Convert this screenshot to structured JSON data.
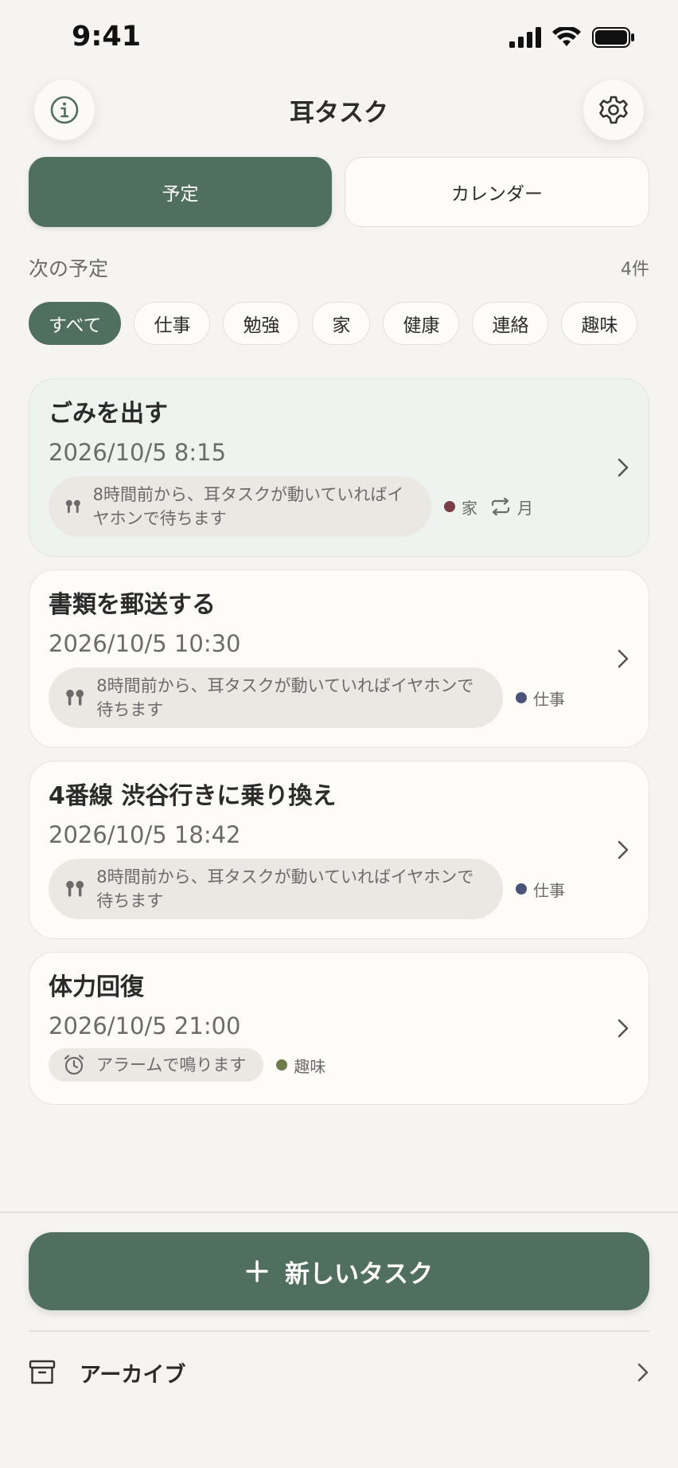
{
  "status": {
    "time": "9:41"
  },
  "header": {
    "title": "耳タスク"
  },
  "segments": [
    {
      "label": "予定",
      "active": true
    },
    {
      "label": "カレンダー",
      "active": false
    }
  ],
  "section": {
    "title": "次の予定",
    "count": "4件"
  },
  "filters": [
    "すべて",
    "仕事",
    "勉強",
    "家",
    "健康",
    "連絡",
    "趣味"
  ],
  "tasks": [
    {
      "title": "ごみを出す",
      "date": "2026/10/5 8:15",
      "notify_icon": "earbuds-icon",
      "notify": "8時間前から、耳タスクが動いていればイヤホンで待ちます",
      "category": "家",
      "category_color": "#7a3e48",
      "repeat": "月"
    },
    {
      "title": "書類を郵送する",
      "date": "2026/10/5 10:30",
      "notify_icon": "earbuds-icon",
      "notify": "8時間前から、耳タスクが動いていればイヤホンで待ちます",
      "category": "仕事",
      "category_color": "#4a5478"
    },
    {
      "title": "4番線 渋谷行きに乗り換え",
      "date": "2026/10/5 18:42",
      "notify_icon": "earbuds-icon",
      "notify": "8時間前から、耳タスクが動いていればイヤホンで待ちます",
      "category": "仕事",
      "category_color": "#4a5478"
    },
    {
      "title": "体力回復",
      "date": "2026/10/5 21:00",
      "notify_icon": "alarm-clock-icon",
      "notify": "アラームで鳴ります",
      "category": "趣味",
      "category_color": "#6e7d4b"
    }
  ],
  "actions": {
    "new_task": "新しいタスク",
    "archive": "アーカイブ"
  },
  "colors": {
    "accent": "#506f5e",
    "background": "#f5f4f2",
    "card": "#fdfcf9",
    "highlight_card": "#eef3ef"
  }
}
